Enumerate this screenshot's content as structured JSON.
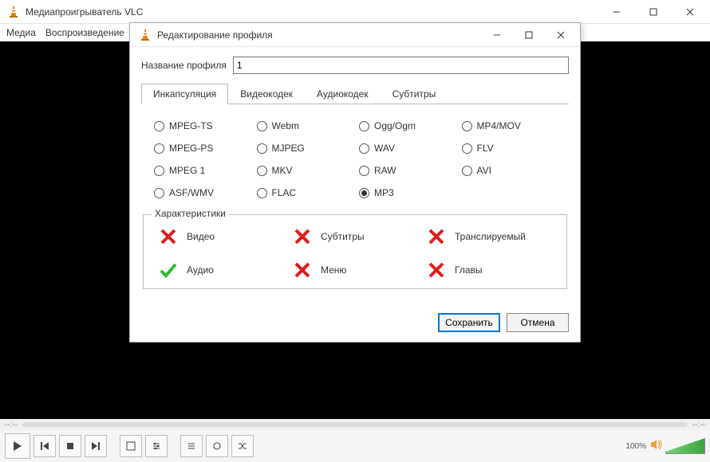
{
  "main": {
    "title": "Медиапроигрыватель VLC",
    "menu": {
      "media": "Медиа",
      "playback": "Воспроизведение"
    },
    "time_start": "--:--",
    "time_end": "--:--",
    "volume_pct": "100%"
  },
  "dialog": {
    "title": "Редактирование профиля",
    "profile_name_label": "Название профиля",
    "profile_name_value": "1",
    "tabs": {
      "encapsulation": "Инкапсуляция",
      "videocodec": "Видеокодек",
      "audiocodec": "Аудиокодек",
      "subtitles": "Субтитры"
    },
    "encapsulation": {
      "options": [
        "MPEG-TS",
        "Webm",
        "Ogg/Ogm",
        "MP4/MOV",
        "MPEG-PS",
        "MJPEG",
        "WAV",
        "FLV",
        "MPEG 1",
        "MKV",
        "RAW",
        "AVI",
        "ASF/WMV",
        "FLAC",
        "MP3"
      ],
      "selected": "MP3"
    },
    "characteristics": {
      "legend": "Характеристики",
      "items": [
        {
          "key": "video",
          "label": "Видео",
          "ok": false
        },
        {
          "key": "subtitles",
          "label": "Субтитры",
          "ok": false
        },
        {
          "key": "streamable",
          "label": "Транслируемый",
          "ok": false
        },
        {
          "key": "audio",
          "label": "Аудио",
          "ok": true
        },
        {
          "key": "menu",
          "label": "Меню",
          "ok": false
        },
        {
          "key": "chapters",
          "label": "Главы",
          "ok": false
        }
      ]
    },
    "buttons": {
      "save": "Сохранить",
      "cancel": "Отмена"
    }
  }
}
